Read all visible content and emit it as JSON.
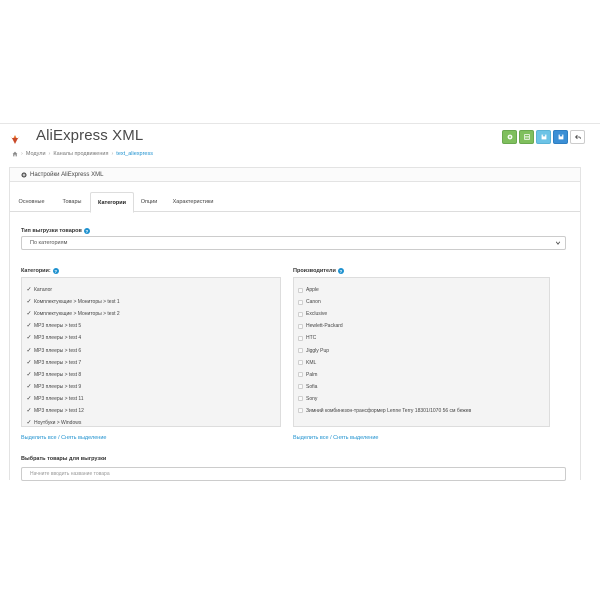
{
  "header": {
    "title": "AliExpress XML",
    "breadcrumb": [
      "Модули",
      "Каналы продвижения",
      "text_aliexpress"
    ]
  },
  "toolbar": {
    "buttons": [
      {
        "icon": "gear-icon",
        "color": "#7fbf5d"
      },
      {
        "icon": "grid-icon",
        "color": "#7fbf5d"
      },
      {
        "icon": "save-icon",
        "color": "#6cc3e6"
      },
      {
        "icon": "save-icon",
        "color": "#3b8fd5"
      },
      {
        "icon": "back-arrow-icon",
        "color": "#ffffff"
      }
    ]
  },
  "panel": {
    "heading": "Настройки AliExpress XML",
    "tabs": [
      "Основные",
      "Товары",
      "Категории",
      "Опции",
      "Характеристики"
    ],
    "active_tab": "Категории"
  },
  "export_type": {
    "label": "Тип выгрузки товаров",
    "selected": "По категориям"
  },
  "categories": {
    "label": "Категории:",
    "items": [
      {
        "text": "Каталог",
        "checked": true
      },
      {
        "text": "Комплектующие  >  Мониторы  >  test 1",
        "checked": true
      },
      {
        "text": "Комплектующие  >  Мониторы  >  test 2",
        "checked": true
      },
      {
        "text": "MP3 плееры  >  test 5",
        "checked": true
      },
      {
        "text": "MP3 плееры  >  test 4",
        "checked": true
      },
      {
        "text": "MP3 плееры  >  test 6",
        "checked": true
      },
      {
        "text": "MP3 плееры  >  test 7",
        "checked": true
      },
      {
        "text": "MP3 плееры  >  test 8",
        "checked": true
      },
      {
        "text": "MP3 плееры  >  test 9",
        "checked": true
      },
      {
        "text": "MP3 плееры  >  test 11",
        "checked": true
      },
      {
        "text": "MP3 плееры  >  test 12",
        "checked": true
      },
      {
        "text": "Ноутбуки  >  Windows",
        "checked": true
      }
    ],
    "select_link": "Выделить все / Снять выделение"
  },
  "manufacturers": {
    "label": "Производители",
    "items": [
      {
        "text": "Apple",
        "checked": false
      },
      {
        "text": "Canon",
        "checked": false
      },
      {
        "text": "Exclusive",
        "checked": false
      },
      {
        "text": "Hewlett-Packard",
        "checked": false
      },
      {
        "text": "HTC",
        "checked": false
      },
      {
        "text": "Jiggly Pup",
        "checked": false
      },
      {
        "text": "KML",
        "checked": false
      },
      {
        "text": "Palm",
        "checked": false
      },
      {
        "text": "Sofia",
        "checked": false
      },
      {
        "text": "Sony",
        "checked": false
      },
      {
        "text": "Зимний комбинезон-трансформер Lenne Terry 18301/1070 56 см бежев",
        "checked": false
      }
    ],
    "select_link": "Выделить все / Снять выделение"
  },
  "product_select": {
    "label": "Выбрать товары для выгрузки",
    "placeholder": "Начните вводить название товара"
  }
}
